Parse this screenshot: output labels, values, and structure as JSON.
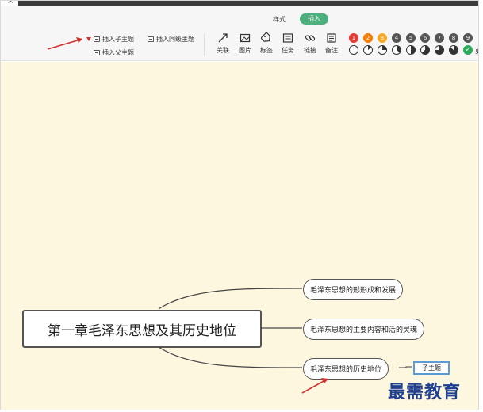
{
  "tabs": {
    "style": "样式",
    "insert": "插入"
  },
  "toolbar": {
    "insert_child": "插入子主题",
    "insert_sibling": "插入同级主题",
    "insert_parent": "插入父主题",
    "tools": [
      {
        "label": "关联",
        "icon": "arrow-icon"
      },
      {
        "label": "图片",
        "icon": "image-icon"
      },
      {
        "label": "标签",
        "icon": "tag-icon"
      },
      {
        "label": "任务",
        "icon": "task-icon"
      },
      {
        "label": "链接",
        "icon": "link-icon"
      },
      {
        "label": "备注",
        "icon": "note-icon"
      }
    ],
    "priority_badges": [
      {
        "label": "1",
        "color": "#e53935"
      },
      {
        "label": "2",
        "color": "#f57c00"
      },
      {
        "label": "3",
        "color": "#f9a825"
      },
      {
        "label": "4",
        "color": "#555555"
      },
      {
        "label": "5",
        "color": "#555555"
      },
      {
        "label": "6",
        "color": "#555555"
      },
      {
        "label": "7",
        "color": "#555555"
      },
      {
        "label": "8",
        "color": "#555555"
      },
      {
        "label": "9",
        "color": "#555555"
      }
    ],
    "progress_levels": [
      0,
      0.125,
      0.25,
      0.375,
      0.5,
      0.625,
      0.75,
      0.875
    ],
    "done_color": "#2eab5a",
    "cut_char": "更"
  },
  "mindmap": {
    "central": "第一章毛泽东思想及其历史地位",
    "subtopics": [
      "毛泽东思想的形形成和发展",
      "毛泽东思想的主要内容和活的灵魂",
      "毛泽东思想的历史地位"
    ],
    "child": "子主题"
  },
  "watermark": "最需教育",
  "colors": {
    "canvas": "#fdf7e0",
    "accent": "#4caf7d",
    "arrow": "#d32f2f"
  }
}
